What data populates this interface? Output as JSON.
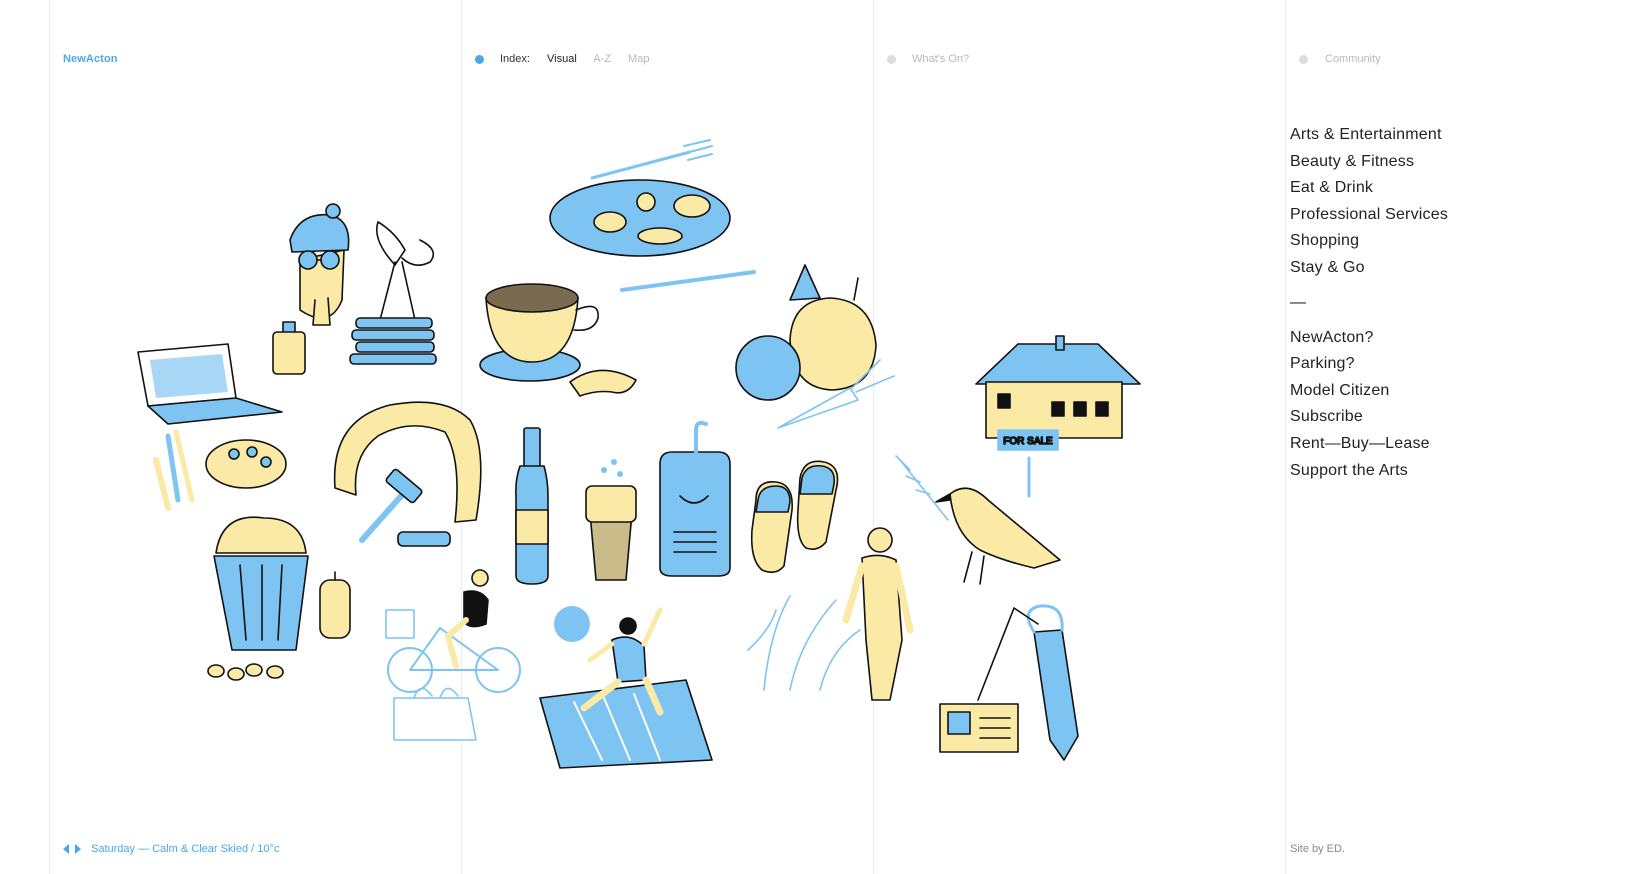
{
  "brand": "NewActon",
  "colors": {
    "accent_blue": "#4aa8e6",
    "illustration_blue": "#7ec4f2",
    "illustration_yellow": "#fbe9a6",
    "muted_gray": "#b8b8b8",
    "dot_gray": "#dddddd"
  },
  "index_nav": {
    "label": "Index:",
    "visual": "Visual",
    "az": "A-Z",
    "map": "Map"
  },
  "whats_on": "What's On?",
  "community": "Community",
  "menu": {
    "primary": [
      "Arts & Entertainment",
      "Beauty & Fitness",
      "Eat & Drink",
      "Professional Services",
      "Shopping",
      "Stay & Go"
    ],
    "separator": "—",
    "secondary": [
      "NewActon?",
      "Parking?",
      "Model Citizen",
      "Subscribe",
      "Rent—Buy—Lease",
      "Support the Arts"
    ]
  },
  "footer": {
    "weather": "Saturday — Calm & Clear Skied / 10°c",
    "credit": "Site by ED."
  },
  "illustrations": [
    "reading-person-icon",
    "scissors-trophy-icon",
    "bottle-icon",
    "laptop-icon",
    "paint-brushes-icon",
    "palette-icon",
    "scarf-icon",
    "hammer-icon",
    "cupcake-icon",
    "lantern-icon",
    "cookies-icon",
    "plate-food-icon",
    "fork-icon",
    "knife-icon",
    "coffee-cup-icon",
    "croissant-icon",
    "apples-pumpkin-icon",
    "carrot-icon",
    "house-for-sale-icon",
    "wine-bottle-icon",
    "beer-glass-icon",
    "bath-mitt-icon",
    "slippers-icon",
    "cyclist-icon",
    "shopping-bag-icon",
    "ball-icon",
    "yoga-mat-icon",
    "fern-icon",
    "bird-icon",
    "naked-man-icon",
    "necktie-icon",
    "id-card-icon"
  ],
  "sale_sign": "FOR SALE"
}
